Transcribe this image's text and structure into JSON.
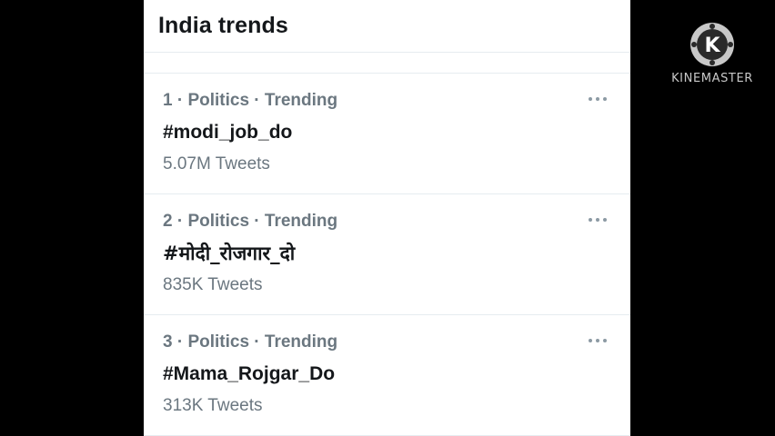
{
  "header": {
    "title": "India trends"
  },
  "trends": [
    {
      "meta": "1 · Politics · Trending",
      "tag": "#modi_job_do",
      "count": "5.07M Tweets"
    },
    {
      "meta": "2 · Politics · Trending",
      "tag": "#मोदी_रोजगार_दो",
      "count": "835K Tweets"
    },
    {
      "meta": "3 · Politics · Trending",
      "tag": "#Mama_Rojgar_Do",
      "count": "313K Tweets"
    }
  ],
  "more_icon": "more-horizontal-icon",
  "watermark": {
    "icon": "kinemaster-logo",
    "text": "KINEMASTER"
  },
  "colors": {
    "background": "#000000",
    "panel": "#ffffff",
    "text_primary": "#14171a",
    "text_secondary": "#6b7780",
    "divider": "#e6ecf0"
  }
}
